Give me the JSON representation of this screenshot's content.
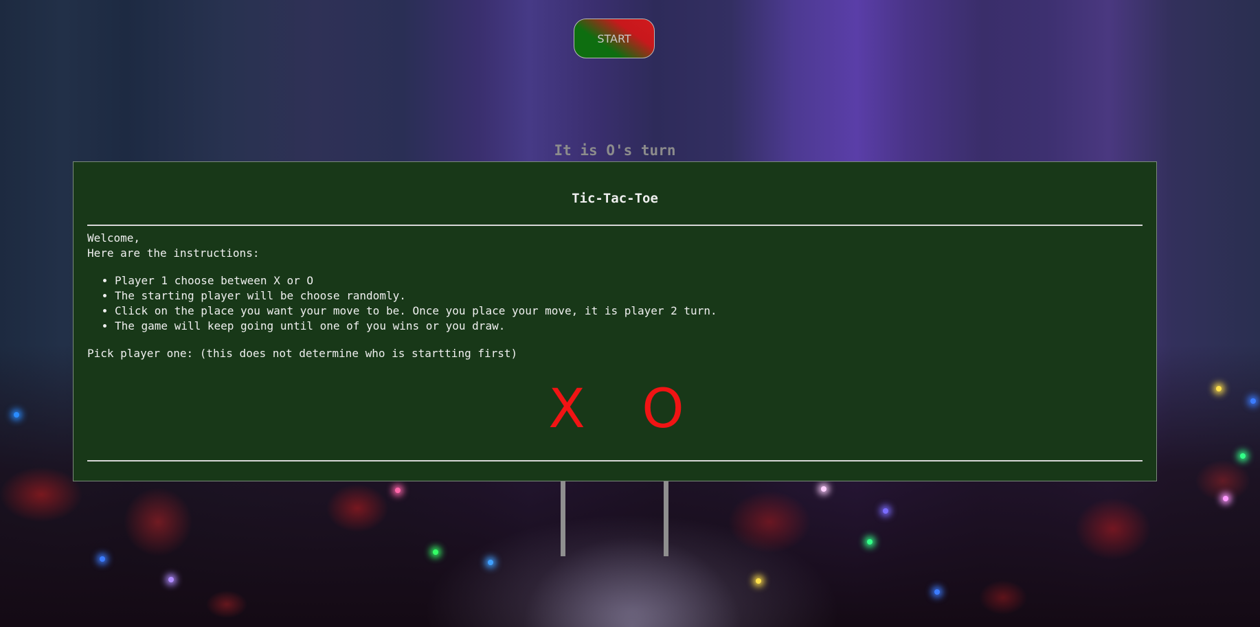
{
  "start_button": {
    "label": "START"
  },
  "status": {
    "turn_text": "It is O's turn"
  },
  "modal": {
    "title": "Tic-Tac-Toe",
    "greeting": "Welcome,",
    "intro": "Here are the instructions:",
    "instructions": [
      "Player 1 choose between X or O",
      "The starting player will be choose randomly.",
      "Click on the place you want your move to be. Once you place your move, it is player 2 turn.",
      "The game will keep going until one of you wins or you draw."
    ],
    "pick_prompt": "Pick player one: (this does not determine who is startting first)",
    "choices": [
      "X",
      "O"
    ]
  },
  "colors": {
    "modal_background": "#183818",
    "choice_color": "#f01414",
    "turn_text_color": "#8c8c8c"
  }
}
